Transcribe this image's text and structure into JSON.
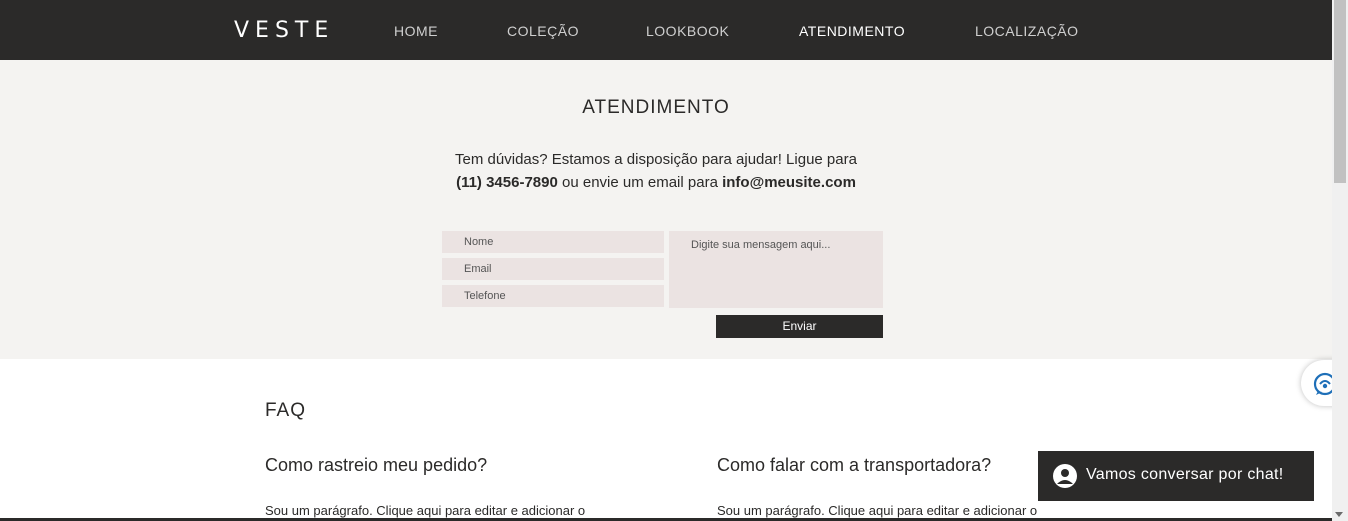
{
  "header": {
    "logo": "VESTE",
    "nav": [
      {
        "label": "HOME"
      },
      {
        "label": "COLEÇÃO"
      },
      {
        "label": "LOOKBOOK"
      },
      {
        "label": "ATENDIMENTO",
        "active": true
      },
      {
        "label": "LOCALIZAÇÃO"
      }
    ]
  },
  "contact": {
    "title": "ATENDIMENTO",
    "intro_text": "Tem dúvidas? Estamos a disposição para ajudar! Ligue para",
    "phone": "(11) 3456-7890",
    "middle_text": " ou envie um email para ",
    "email": "info@meusite.com",
    "form": {
      "name_placeholder": "Nome",
      "email_placeholder": "Email",
      "phone_placeholder": "Telefone",
      "message_placeholder": "Digite sua mensagem aqui...",
      "submit_label": "Enviar"
    }
  },
  "faq": {
    "title": "FAQ",
    "items": [
      {
        "question": "Como rastreio meu pedido?",
        "answer": "Sou um parágrafo. Clique aqui para editar e adicionar o"
      },
      {
        "question": "Como falar com a transportadora?",
        "answer": "Sou um parágrafo. Clique aqui para editar e adicionar o"
      }
    ]
  },
  "chat": {
    "label": "Vamos conversar por chat!"
  },
  "colors": {
    "header_bg": "#2b2a29",
    "section_bg": "#f4f3f1",
    "field_bg": "#ebe3e2",
    "chat_icon_blue": "#1e6fb8"
  }
}
